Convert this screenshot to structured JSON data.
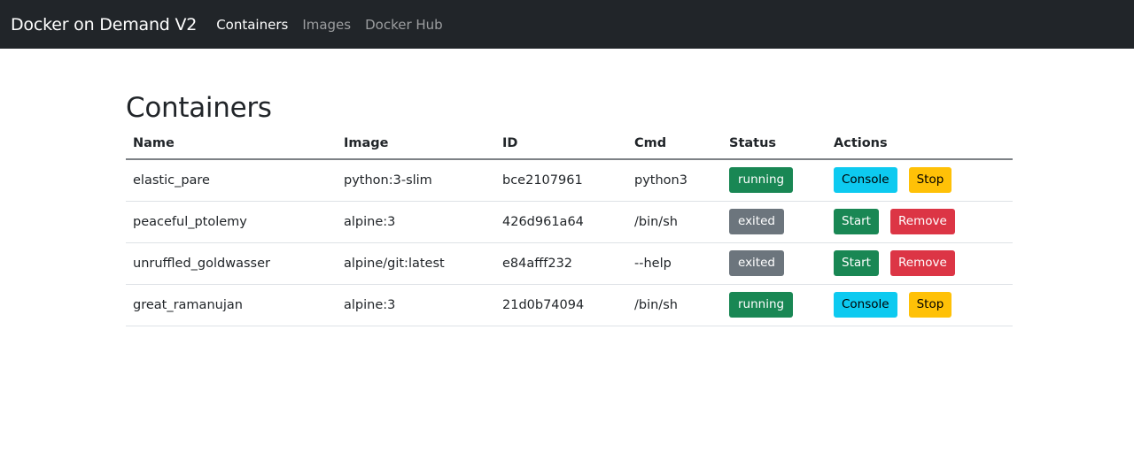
{
  "navbar": {
    "brand": "Docker on Demand V2",
    "links": [
      {
        "label": "Containers",
        "active": true
      },
      {
        "label": "Images",
        "active": false
      },
      {
        "label": "Docker Hub",
        "active": false
      }
    ]
  },
  "page": {
    "title": "Containers"
  },
  "table": {
    "headers": [
      "Name",
      "Image",
      "ID",
      "Cmd",
      "Status",
      "Actions"
    ],
    "rows": [
      {
        "name": "elastic_pare",
        "image": "python:3-slim",
        "id": "bce2107961",
        "cmd": "python3",
        "status": "running",
        "actions": [
          {
            "label": "Console",
            "variant": "info"
          },
          {
            "label": "Stop",
            "variant": "warning"
          }
        ]
      },
      {
        "name": "peaceful_ptolemy",
        "image": "alpine:3",
        "id": "426d961a64",
        "cmd": "/bin/sh",
        "status": "exited",
        "actions": [
          {
            "label": "Start",
            "variant": "success"
          },
          {
            "label": "Remove",
            "variant": "danger"
          }
        ]
      },
      {
        "name": "unruffled_goldwasser",
        "image": "alpine/git:latest",
        "id": "e84afff232",
        "cmd": "--help",
        "status": "exited",
        "actions": [
          {
            "label": "Start",
            "variant": "success"
          },
          {
            "label": "Remove",
            "variant": "danger"
          }
        ]
      },
      {
        "name": "great_ramanujan",
        "image": "alpine:3",
        "id": "21d0b74094",
        "cmd": "/bin/sh",
        "status": "running",
        "actions": [
          {
            "label": "Console",
            "variant": "info"
          },
          {
            "label": "Stop",
            "variant": "warning"
          }
        ]
      }
    ]
  },
  "colors": {
    "navbar_bg": "#212529",
    "running": "#198754",
    "exited": "#6c757d",
    "info": "#0dcaf0",
    "warning": "#ffc107",
    "success": "#198754",
    "danger": "#dc3545"
  }
}
